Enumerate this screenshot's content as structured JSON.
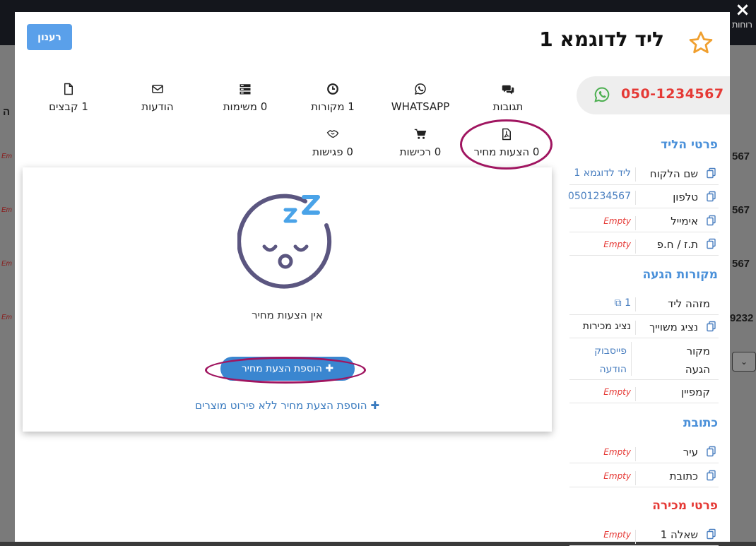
{
  "background": {
    "fragments": [
      "ה",
      "רוחות",
      "567",
      "567",
      "567",
      "9232",
      "Em",
      "Em",
      "Em",
      "Em"
    ]
  },
  "modal": {
    "refresh_label": "רענון",
    "title": "ליד לדוגמא 1",
    "phone": "050-1234567",
    "close_icon": "×"
  },
  "tabs": [
    {
      "label": "תגובות",
      "icon": "comments-icon"
    },
    {
      "label": "WHATSAPP",
      "icon": "whatsapp-icon"
    },
    {
      "label": "1 מקורות",
      "icon": "clock-icon"
    },
    {
      "label": "0 משימות",
      "icon": "tasks-icon"
    },
    {
      "label": "הודעות",
      "icon": "envelope-icon"
    },
    {
      "label": "1 קבצים",
      "icon": "file-icon"
    },
    {
      "label": "0 הצעות מחיר",
      "icon": "pdf-file-icon"
    },
    {
      "label": "0 רכישות",
      "icon": "cart-icon"
    },
    {
      "label": "0 פגישות",
      "icon": "handshake-icon"
    }
  ],
  "content": {
    "empty_message": "אין הצעות מחיר",
    "add_button": "הוספת הצעת מחיר",
    "add_link": "הוספת הצעת מחיר ללא פירוט מוצרים"
  },
  "panel": {
    "lead_details": {
      "title": "פרטי הליד",
      "rows": [
        {
          "label": "שם הלקוח",
          "value": "ליד לדוגמא 1"
        },
        {
          "label": "טלפון",
          "value": "0501234567"
        },
        {
          "label": "אימייל",
          "value": "Empty"
        },
        {
          "label": "ת.ז / ח.פ",
          "value": "Empty"
        }
      ]
    },
    "sources": {
      "title": "מקורות הגעה",
      "rows": [
        {
          "label": "מזהה ליד",
          "value": "1"
        },
        {
          "label": "נציג משוייך",
          "value": "נציג מכירות"
        },
        {
          "label": "מקור הגעה",
          "value": "פייסבוק הודעה"
        },
        {
          "label": "קמפיין",
          "value": "Empty"
        }
      ]
    },
    "address": {
      "title": "כתובת",
      "rows": [
        {
          "label": "עיר",
          "value": "Empty"
        },
        {
          "label": "כתובת",
          "value": "Empty"
        }
      ]
    },
    "sale_details": {
      "title": "פרטי מכירה",
      "rows": [
        {
          "label": "שאלה 1",
          "value": "Empty"
        }
      ]
    }
  },
  "colors": {
    "accent_blue": "#4a90d9",
    "button_blue": "#3a86d0",
    "phone_red": "#e53935",
    "highlight": "#a01560",
    "star": "#f0a030",
    "whatsapp": "#4caf50"
  }
}
